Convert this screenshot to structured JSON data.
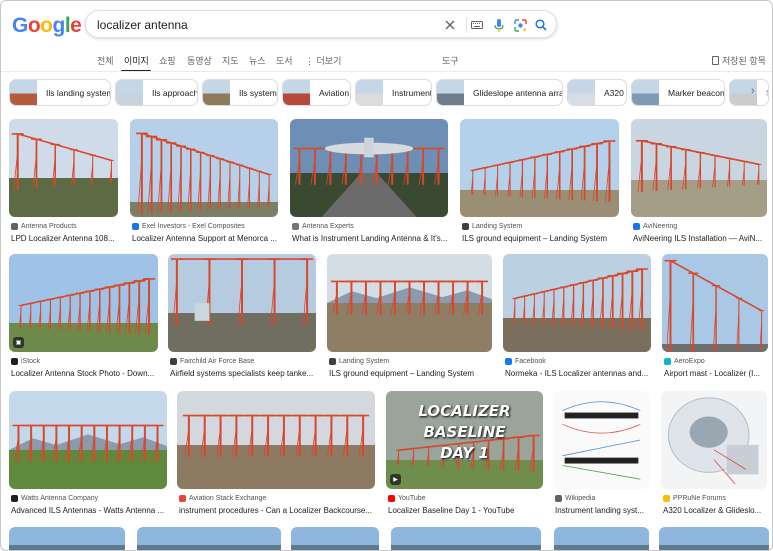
{
  "logo": [
    "G",
    "o",
    "o",
    "g",
    "l",
    "e"
  ],
  "logo_colors": [
    "#4285f4",
    "#ea4335",
    "#fbbc05",
    "#4285f4",
    "#34a853",
    "#ea4335"
  ],
  "search": {
    "query": "localizer antenna"
  },
  "nav": {
    "tabs": [
      "전체",
      "이미지",
      "쇼핑",
      "동영상",
      "지도",
      "뉴스",
      "도서",
      "더보기"
    ],
    "tools": "도구",
    "saved": "저장된 항목"
  },
  "chips": [
    "Ils landing system",
    "Ils approach",
    "Ils system",
    "Aviation",
    "Instrument",
    "Glideslope antenna array",
    "A320",
    "Marker beacon",
    "Ma"
  ],
  "rows": [
    [
      {
        "source": "Antenna Products",
        "title": "LPD Localizer Antenna 108...",
        "fav": "#5f6368"
      },
      {
        "source": "Exel Investors - Exel Composites",
        "title": "Localizer Antenna Support at Menorca ...",
        "fav": "#1a73e8"
      },
      {
        "source": "Antenna Experts",
        "title": "What is Instrument Landing Antenna & It's...",
        "fav": "#70757a"
      },
      {
        "source": "Landing System",
        "title": "ILS ground equipment – Landing System",
        "fav": "#3c4043"
      },
      {
        "source": "AviNeering",
        "title": "AviNeering ILS Installation — AviN...",
        "fav": "#1a73e8"
      }
    ],
    [
      {
        "source": "iStock",
        "title": "Localizer Antenna Stock Photo - Down...",
        "fav": "#202124"
      },
      {
        "source": "Fairchild Air Force Base",
        "title": "Airfield systems specialists keep tanke...",
        "fav": "#3c4043"
      },
      {
        "source": "Landing System",
        "title": "ILS ground equipment – Landing System",
        "fav": "#3c4043"
      },
      {
        "source": "Facebook",
        "title": "Normeka - ILS Localizer antennas and...",
        "fav": "#1877f2"
      },
      {
        "source": "AeroExpo",
        "title": "Airport mast - Localizer (I...",
        "fav": "#12b5cb"
      }
    ],
    [
      {
        "source": "Watts Antenna Company",
        "title": "Advanced ILS Antennas - Watts Antenna ...",
        "fav": "#202124"
      },
      {
        "source": "Aviation Stack Exchange",
        "title": "instrument procedures - Can a Localizer Backcourse...",
        "fav": "#e8453c"
      },
      {
        "source": "YouTube",
        "title": "Localizer Baseline Day 1 - YouTube",
        "fav": "#ff0000"
      },
      {
        "source": "Wikipedia",
        "title": "Instrument landing syst...",
        "fav": "#5f6368"
      },
      {
        "source": "PPRuNe Forums",
        "title": "A320 Localizer & Glideslo...",
        "fav": "#fbbc05"
      }
    ]
  ],
  "thumb_text": {
    "youtube_overlay": [
      "LOCALIZER",
      "BASELINE",
      "DAY 1"
    ]
  },
  "colors": {
    "accent": "#1a73e8",
    "antenna_red": "#d9472b",
    "sky": "#b9d3ea",
    "grass": "#6f8a4a"
  }
}
